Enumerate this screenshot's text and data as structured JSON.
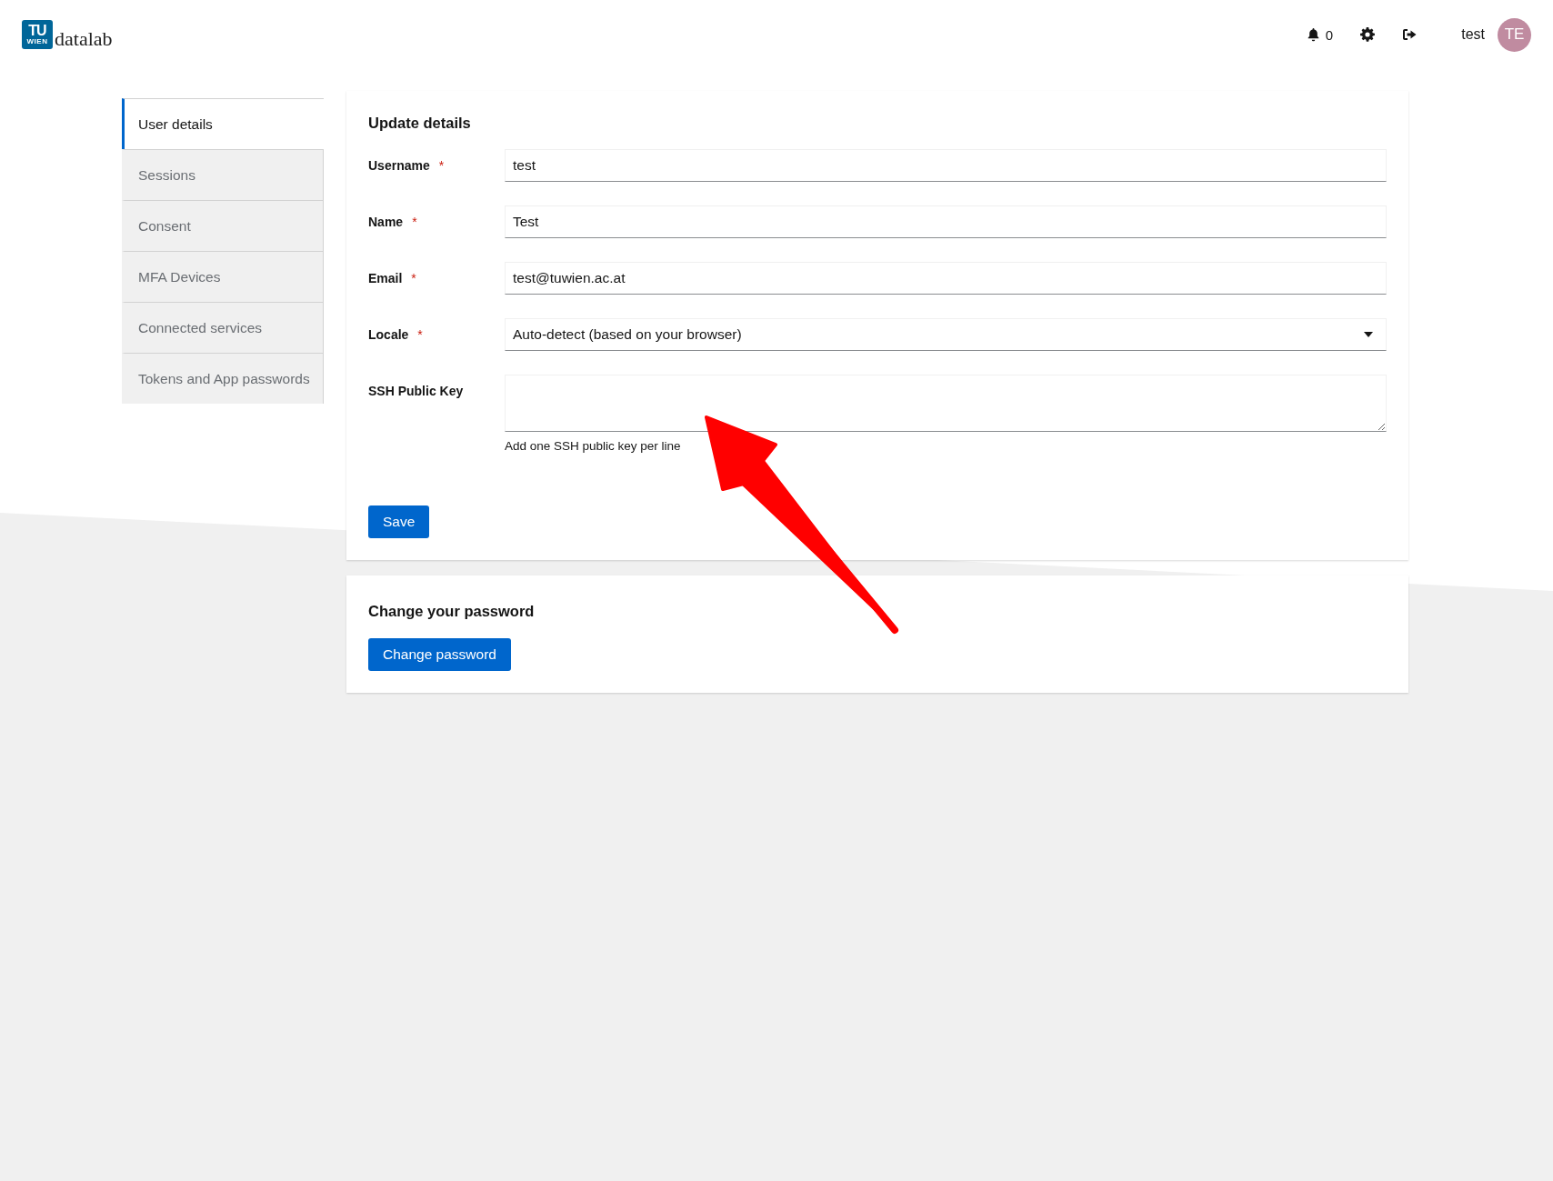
{
  "header": {
    "logo_mark": "TU",
    "logo_sub": "WIEN",
    "logo_text": "datalab",
    "notification_count": "0",
    "username": "test",
    "avatar_initials": "TE"
  },
  "sidebar": {
    "items": [
      {
        "label": "User details",
        "selected": true
      },
      {
        "label": "Sessions",
        "selected": false
      },
      {
        "label": "Consent",
        "selected": false
      },
      {
        "label": "MFA Devices",
        "selected": false
      },
      {
        "label": "Connected services",
        "selected": false
      },
      {
        "label": "Tokens and App passwords",
        "selected": false
      }
    ]
  },
  "details_card": {
    "title": "Update details",
    "fields": [
      {
        "kind": "text",
        "label": "Username",
        "required_mark": "*",
        "value": "test"
      },
      {
        "kind": "text",
        "label": "Name",
        "required_mark": "*",
        "value": "Test"
      },
      {
        "kind": "text",
        "label": "Email",
        "required_mark": "*",
        "value": "test@tuwien.ac.at"
      },
      {
        "kind": "select",
        "label": "Locale",
        "required_mark": "*",
        "value": "Auto-detect (based on your browser)"
      },
      {
        "kind": "textarea",
        "label": "SSH Public Key",
        "help": "Add one SSH public key per line"
      }
    ],
    "button": "Save"
  },
  "password_card": {
    "title": "Change your password",
    "button": "Change password"
  },
  "annotation": {
    "kind": "arrow"
  }
}
